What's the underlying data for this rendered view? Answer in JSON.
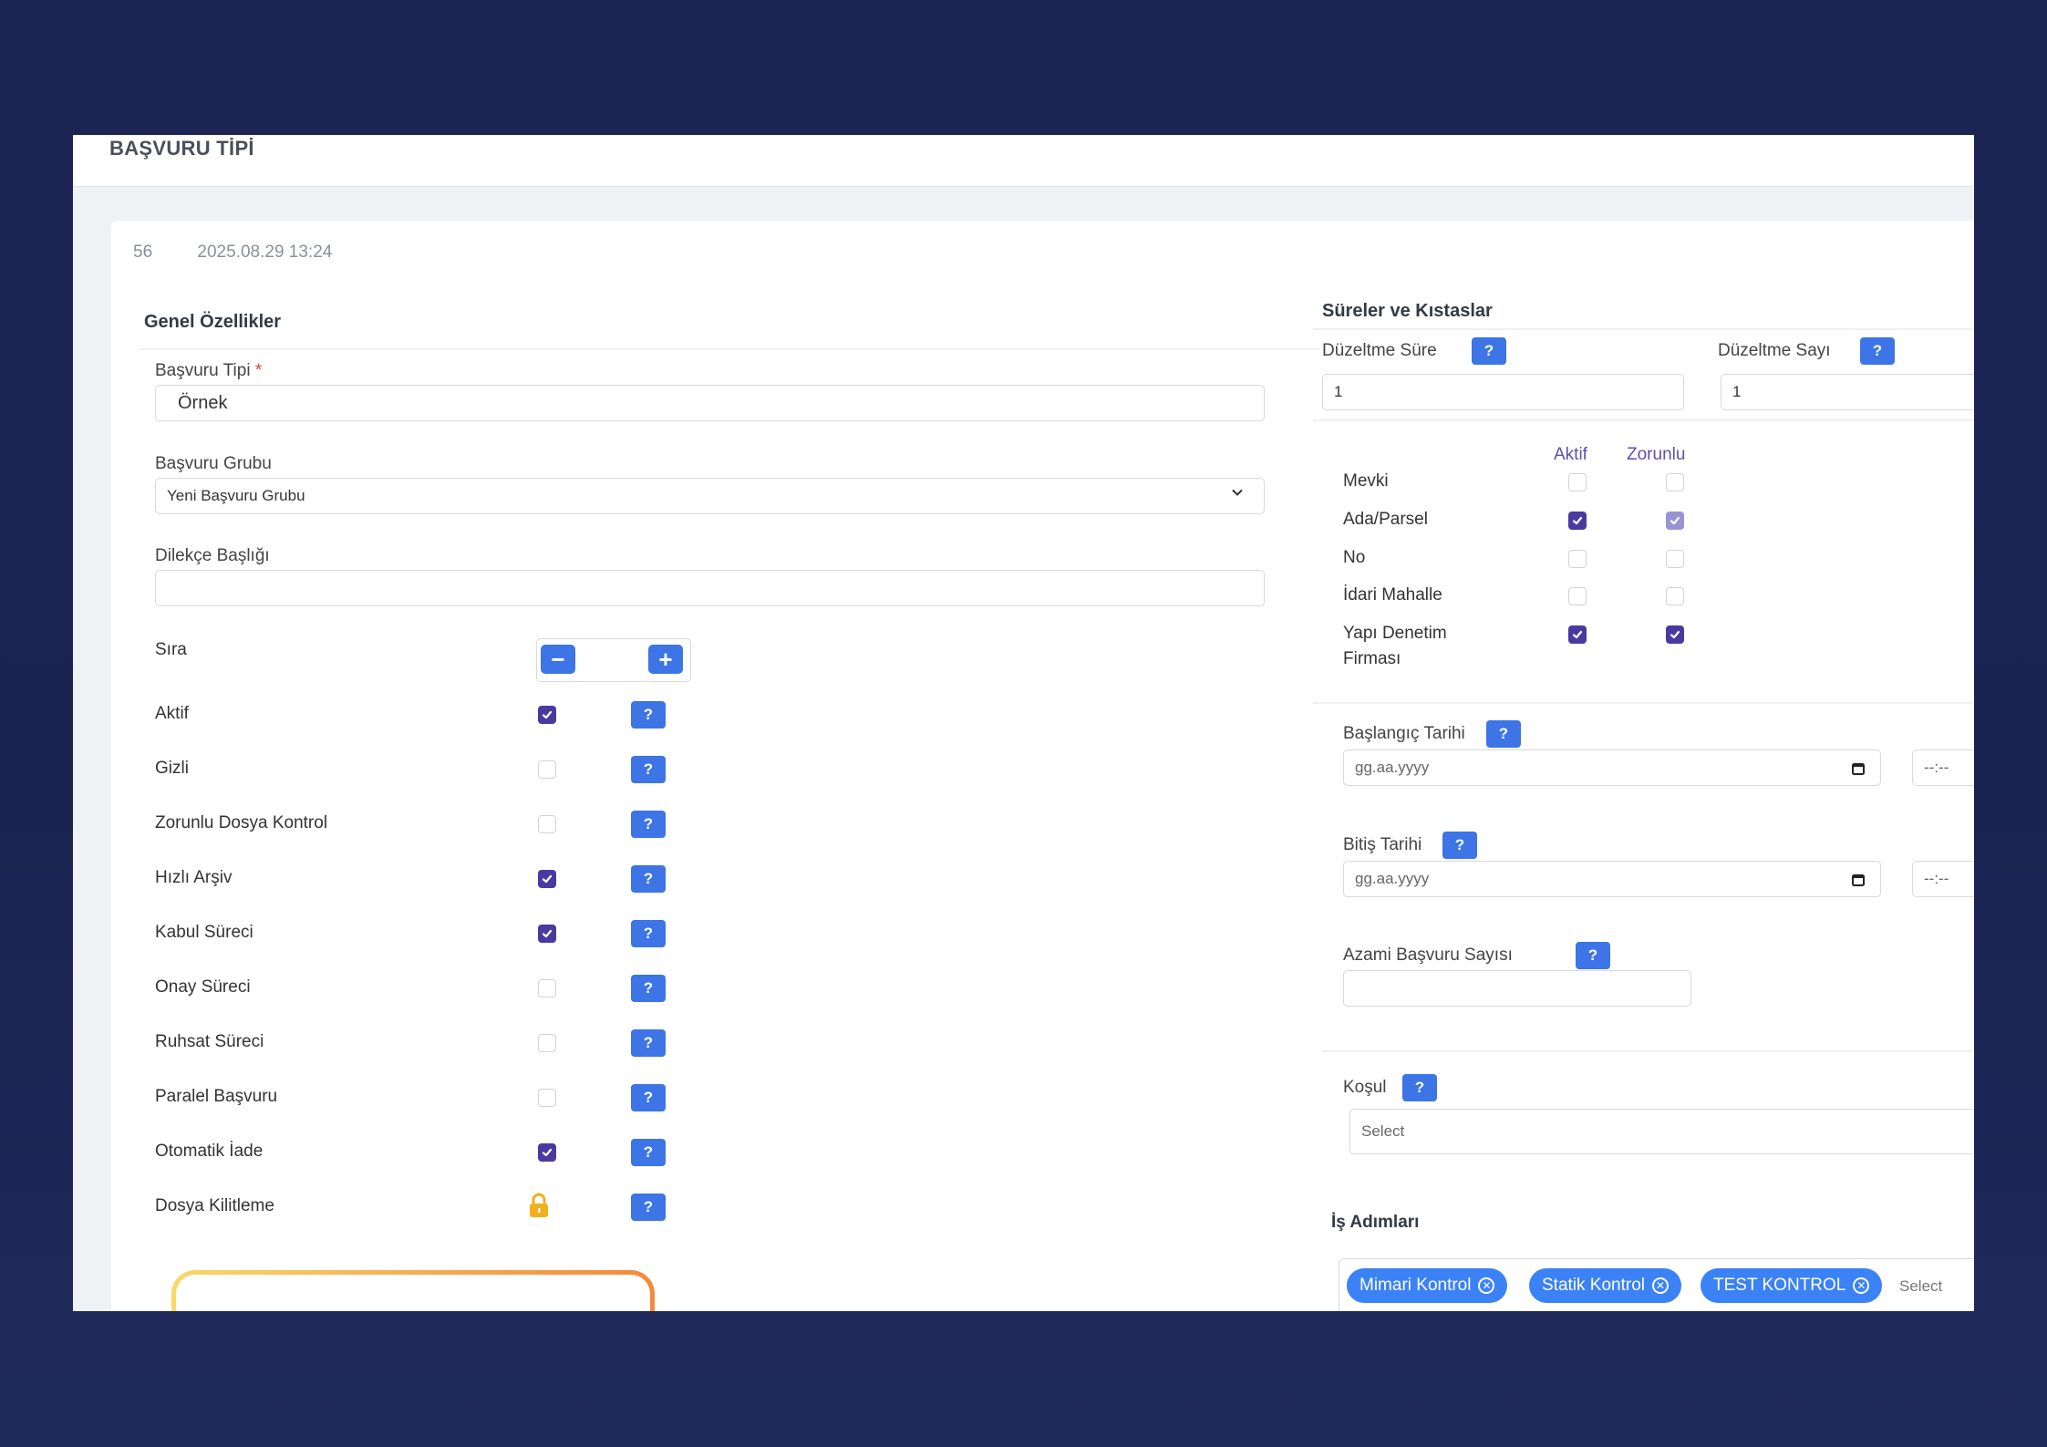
{
  "page": {
    "title": "BAŞVURU TİPİ",
    "record_id": "56",
    "record_date": "2025.08.29 13:24"
  },
  "general": {
    "section_title": "Genel Özellikler",
    "basvuru_tipi": {
      "label": "Başvuru Tipi",
      "required_mark": "*",
      "value": "Örnek"
    },
    "basvuru_grubu": {
      "label": "Başvuru Grubu",
      "value": "Yeni Başvuru Grubu"
    },
    "dilekce_basligi": {
      "label": "Dilekçe Başlığı",
      "value": ""
    },
    "sira": {
      "label": "Sıra",
      "minus": "−",
      "plus": "+"
    },
    "help_label": "?",
    "options": [
      {
        "label": "Aktif",
        "checked": true
      },
      {
        "label": "Gizli",
        "checked": false
      },
      {
        "label": "Zorunlu Dosya Kontrol",
        "checked": false
      },
      {
        "label": "Hızlı Arşiv",
        "checked": true
      },
      {
        "label": "Kabul Süreci",
        "checked": true
      },
      {
        "label": "Onay Süreci",
        "checked": false
      },
      {
        "label": "Ruhsat Süreci",
        "checked": false
      },
      {
        "label": "Paralel Başvuru",
        "checked": false
      },
      {
        "label": "Otomatik İade",
        "checked": true
      },
      {
        "label": "Dosya Kilitleme",
        "locked": true
      }
    ]
  },
  "durations": {
    "section_title": "Süreler ve Kıstaslar",
    "duzeltme_sure": {
      "label": "Düzeltme Süre",
      "value": "1"
    },
    "duzeltme_sayi": {
      "label": "Düzeltme Sayı",
      "value": "1"
    },
    "col_aktif": "Aktif",
    "col_zorunlu": "Zorunlu",
    "location_rows": [
      {
        "label": "Mevki",
        "aktif": false,
        "zorunlu": false
      },
      {
        "label": "Ada/Parsel",
        "aktif": true,
        "zorunlu": true
      },
      {
        "label": "No",
        "aktif": false,
        "zorunlu": false
      },
      {
        "label": "İdari Mahalle",
        "aktif": false,
        "zorunlu": false
      },
      {
        "label": "Yapı Denetim",
        "label2": "Firması",
        "aktif": true,
        "zorunlu": true
      }
    ],
    "baslangic_tarihi": {
      "label": "Başlangıç Tarihi",
      "placeholder": "gg.aa.yyyy",
      "time": "--:--"
    },
    "bitis_tarihi": {
      "label": "Bitiş Tarihi",
      "placeholder": "gg.aa.yyyy",
      "time": "--:--"
    },
    "azami_basvuru": {
      "label": "Azami Başvuru Sayısı",
      "value": ""
    },
    "kosul": {
      "label": "Koşul",
      "placeholder": "Select"
    },
    "is_adimlari": {
      "label": "İş Adımları",
      "tags": [
        "Mimari Kontrol",
        "Statik Kontrol",
        "TEST KONTROL"
      ],
      "placeholder": "Select"
    }
  },
  "colors": {
    "primary_blue": "#3d74e6",
    "checkbox_purple": "#4a3aa0",
    "tag_blue": "#3b82f6",
    "highlight": "#f7a552",
    "lock": "#f2b01e"
  }
}
